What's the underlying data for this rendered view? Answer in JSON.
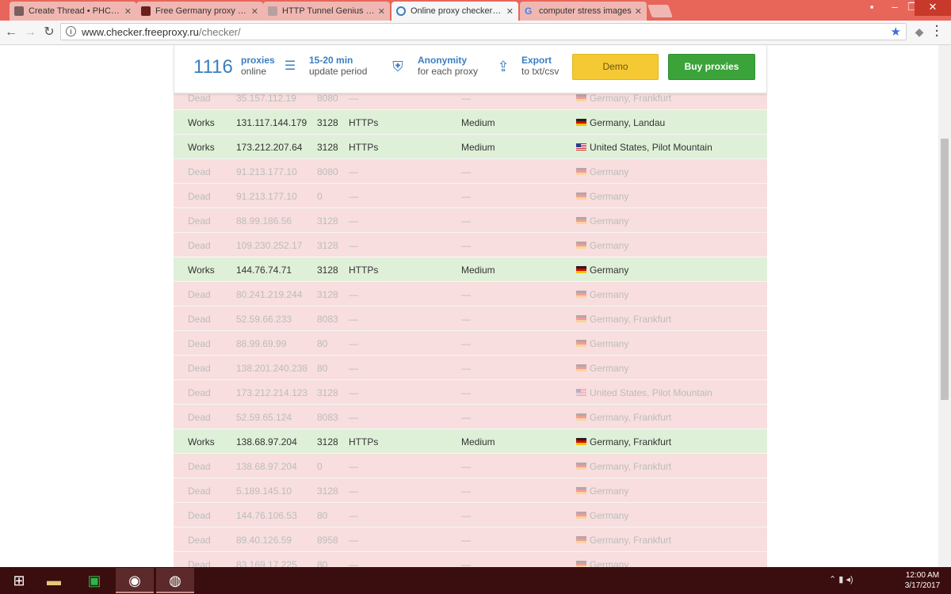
{
  "browser": {
    "tabs": [
      {
        "title": "Create Thread • PHCorner",
        "active": false,
        "favicon_color": "#7a5f5f"
      },
      {
        "title": "Free Germany proxy servers",
        "active": false,
        "favicon_color": "#6b1f1f"
      },
      {
        "title": "HTTP Tunnel Genius - Of",
        "active": false,
        "favicon_color": "#b9a0a0"
      },
      {
        "title": "Online proxy checker: on",
        "active": true,
        "favicon_color": "#3a7ec0"
      },
      {
        "title": "computer stress images",
        "active": false,
        "favicon_color": "#4285f4"
      }
    ],
    "url_host": "www.checker.freeproxy.ru",
    "url_path": "/checker/"
  },
  "header": {
    "count": "1116",
    "proxies_label": "proxies",
    "online_label": "online",
    "update_title": "15-20 min",
    "update_sub": "update period",
    "anon_title": "Anonymity",
    "anon_sub": "for each proxy",
    "export_title": "Export",
    "export_sub": "to txt/csv",
    "demo_label": "Demo",
    "buy_label": "Buy proxies"
  },
  "rows": [
    {
      "status": "Dead",
      "ip": "35.157.112.19",
      "port": "8080",
      "type": "—",
      "anon": "—",
      "flag": "de",
      "loc": "Germany, Frankfurt"
    },
    {
      "status": "Works",
      "ip": "131.117.144.179",
      "port": "3128",
      "type": "HTTPs",
      "anon": "Medium",
      "flag": "de",
      "loc": "Germany, Landau"
    },
    {
      "status": "Works",
      "ip": "173.212.207.64",
      "port": "3128",
      "type": "HTTPs",
      "anon": "Medium",
      "flag": "us",
      "loc": "United States, Pilot Mountain"
    },
    {
      "status": "Dead",
      "ip": "91.213.177.10",
      "port": "8080",
      "type": "—",
      "anon": "—",
      "flag": "de",
      "loc": "Germany"
    },
    {
      "status": "Dead",
      "ip": "91.213.177.10",
      "port": "0",
      "type": "—",
      "anon": "—",
      "flag": "de",
      "loc": "Germany"
    },
    {
      "status": "Dead",
      "ip": "88.99.186.56",
      "port": "3128",
      "type": "—",
      "anon": "—",
      "flag": "de",
      "loc": "Germany"
    },
    {
      "status": "Dead",
      "ip": "109.230.252.17",
      "port": "3128",
      "type": "—",
      "anon": "—",
      "flag": "de",
      "loc": "Germany"
    },
    {
      "status": "Works",
      "ip": "144.76.74.71",
      "port": "3128",
      "type": "HTTPs",
      "anon": "Medium",
      "flag": "de",
      "loc": "Germany"
    },
    {
      "status": "Dead",
      "ip": "80.241.219.244",
      "port": "3128",
      "type": "—",
      "anon": "—",
      "flag": "de",
      "loc": "Germany"
    },
    {
      "status": "Dead",
      "ip": "52.59.66.233",
      "port": "8083",
      "type": "—",
      "anon": "—",
      "flag": "de",
      "loc": "Germany, Frankfurt"
    },
    {
      "status": "Dead",
      "ip": "88.99.69.99",
      "port": "80",
      "type": "—",
      "anon": "—",
      "flag": "de",
      "loc": "Germany"
    },
    {
      "status": "Dead",
      "ip": "138.201.240.238",
      "port": "80",
      "type": "—",
      "anon": "—",
      "flag": "de",
      "loc": "Germany"
    },
    {
      "status": "Dead",
      "ip": "173.212.214.123",
      "port": "3128",
      "type": "—",
      "anon": "—",
      "flag": "us",
      "loc": "United States, Pilot Mountain"
    },
    {
      "status": "Dead",
      "ip": "52.59.65.124",
      "port": "8083",
      "type": "—",
      "anon": "—",
      "flag": "de",
      "loc": "Germany, Frankfurt"
    },
    {
      "status": "Works",
      "ip": "138.68.97.204",
      "port": "3128",
      "type": "HTTPs",
      "anon": "Medium",
      "flag": "de",
      "loc": "Germany, Frankfurt"
    },
    {
      "status": "Dead",
      "ip": "138.68.97.204",
      "port": "0",
      "type": "—",
      "anon": "—",
      "flag": "de",
      "loc": "Germany, Frankfurt"
    },
    {
      "status": "Dead",
      "ip": "5.189.145.10",
      "port": "3128",
      "type": "—",
      "anon": "—",
      "flag": "de",
      "loc": "Germany"
    },
    {
      "status": "Dead",
      "ip": "144.76.106.53",
      "port": "80",
      "type": "—",
      "anon": "—",
      "flag": "de",
      "loc": "Germany"
    },
    {
      "status": "Dead",
      "ip": "89.40.126.59",
      "port": "8958",
      "type": "—",
      "anon": "—",
      "flag": "de",
      "loc": "Germany, Frankfurt"
    },
    {
      "status": "Dead",
      "ip": "83.169.17.225",
      "port": "80",
      "type": "—",
      "anon": "—",
      "flag": "de",
      "loc": "Germany"
    }
  ],
  "taskbar": {
    "time": "12:00 AM",
    "date": "3/17/2017"
  },
  "colors": {
    "works_bg": "#dff0d8",
    "dead_bg": "#f8dede",
    "accent": "#3a7ec0",
    "demo": "#f5c933",
    "buy": "#3aa33a"
  }
}
